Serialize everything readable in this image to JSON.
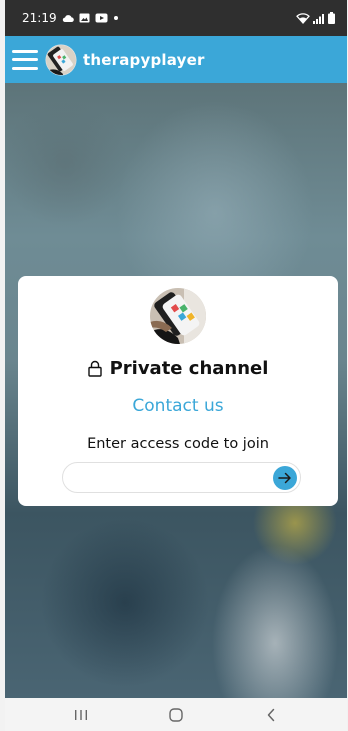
{
  "status_bar": {
    "time": "21:19",
    "icons": [
      "cloud-icon",
      "image-icon",
      "youtube-icon",
      "dot-icon",
      "wifi-icon",
      "signal-icon",
      "battery-icon"
    ]
  },
  "app_bar": {
    "title": "therapyplayer",
    "menu_icon": "hamburger-menu-icon",
    "logo_icon": "therapyplayer-logo-icon"
  },
  "card": {
    "avatar_icon": "channel-avatar-icon",
    "lock_icon": "lock-icon",
    "title": "Private channel",
    "contact_link": "Contact us",
    "access_label": "Enter access code to join",
    "access_code_value": "",
    "access_code_placeholder": "",
    "submit_icon": "arrow-right-icon"
  },
  "nav_bar": {
    "items": [
      "recent-apps-icon",
      "home-icon",
      "back-icon"
    ]
  },
  "colors": {
    "accent": "#3ba7d8",
    "status_bar": "#2f2f2f",
    "card": "#ffffff",
    "nav_bar": "#f4f4f4"
  }
}
